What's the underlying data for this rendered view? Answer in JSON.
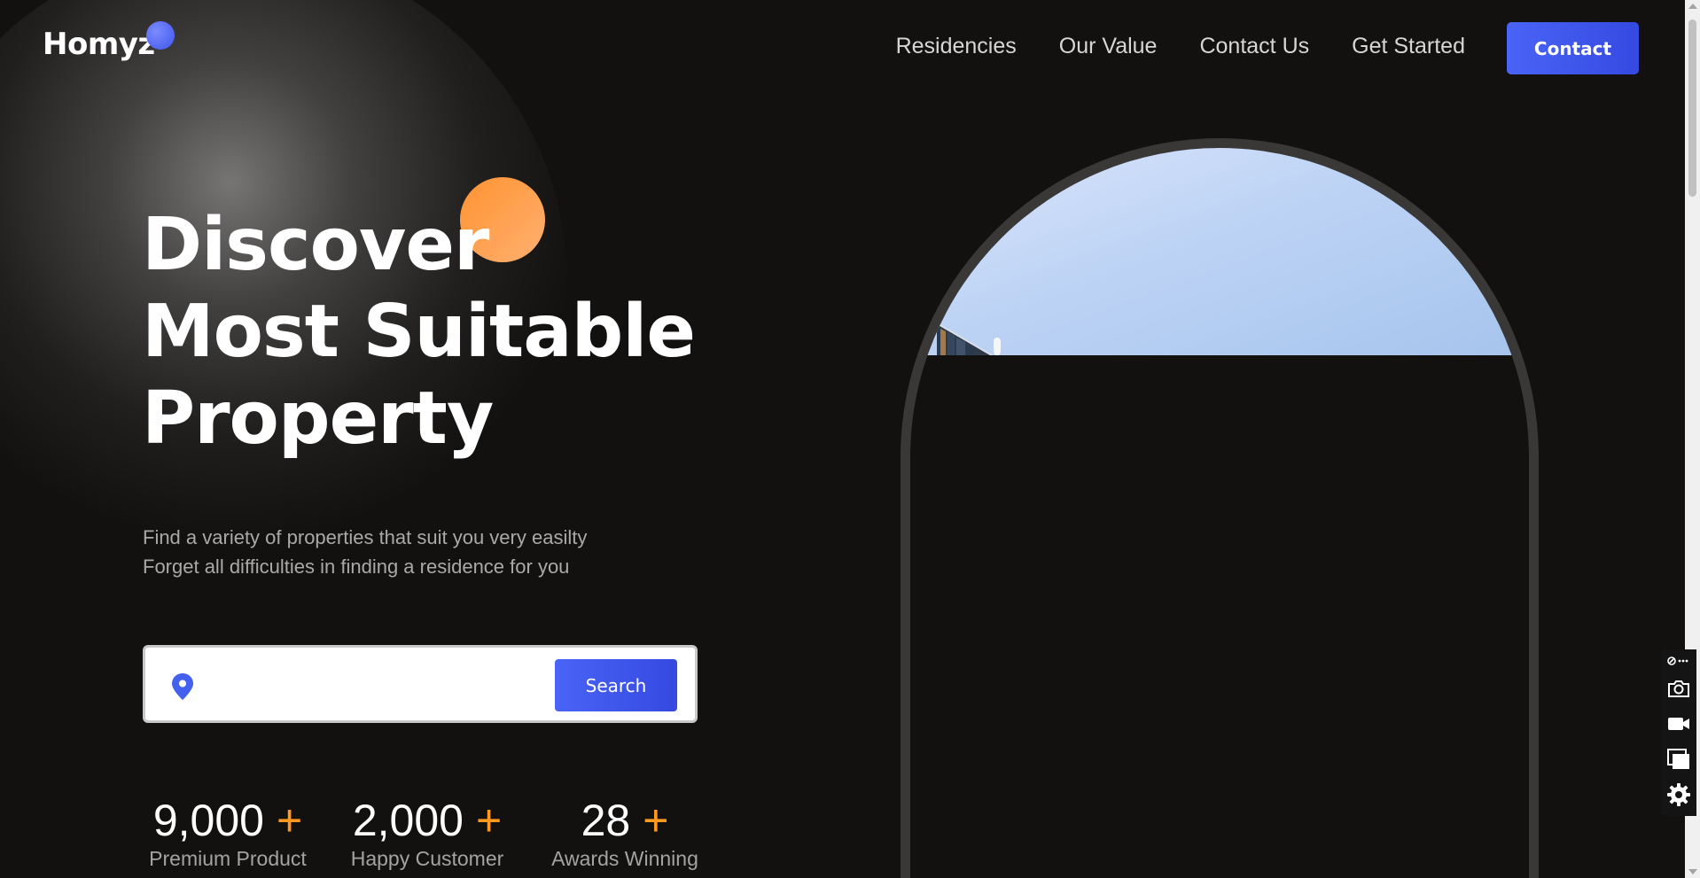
{
  "logo": {
    "text": "Homyz"
  },
  "nav": {
    "items": [
      "Residencies",
      "Our Value",
      "Contact Us",
      "Get Started"
    ],
    "contact_label": "Contact"
  },
  "hero": {
    "title_lines": [
      "Discover",
      "Most Suitable",
      "Property"
    ],
    "subtitle_lines": [
      "Find a variety of properties that suit you very easilty",
      "Forget all difficulties in finding a residence for you"
    ]
  },
  "search": {
    "placeholder": "",
    "button_label": "Search",
    "icon": "location-pin-icon"
  },
  "stats": [
    {
      "value": "9,000",
      "suffix": "+",
      "label": "Premium Product"
    },
    {
      "value": "2,000",
      "suffix": "+",
      "label": "Happy Customer"
    },
    {
      "value": "28",
      "suffix": "+",
      "label": "Awards Winning"
    }
  ],
  "toolbar": {
    "icons": [
      "link-more-icon",
      "camera-icon",
      "video-icon",
      "copy-window-icon",
      "gear-icon"
    ]
  },
  "colors": {
    "background": "#131110",
    "accent_blue": "#4a64f7",
    "accent_orange": "#ff9a1f",
    "text_muted": "#a9a9a9"
  }
}
